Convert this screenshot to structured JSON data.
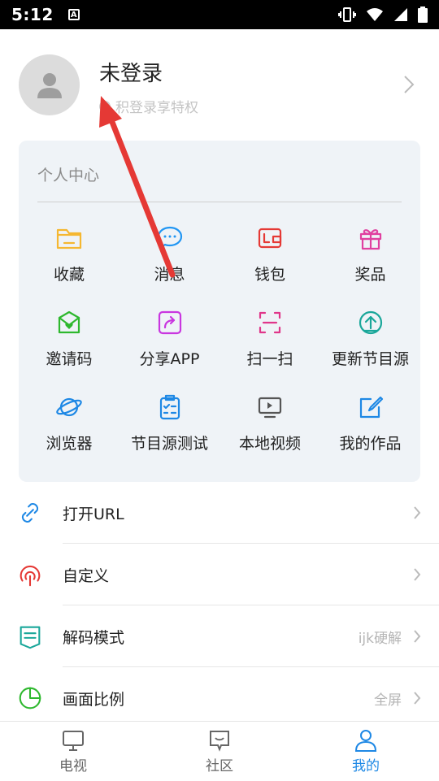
{
  "status_bar": {
    "time": "5:12"
  },
  "profile": {
    "title": "未登录",
    "subtitle": "积登录享特权"
  },
  "personal_center": {
    "title": "个人中心",
    "items": [
      {
        "label": "收藏",
        "icon": "folder-icon",
        "color": "#f5b731"
      },
      {
        "label": "消息",
        "icon": "chat-bubble-icon",
        "color": "#2196f3"
      },
      {
        "label": "钱包",
        "icon": "wallet-icon",
        "color": "#e53935"
      },
      {
        "label": "奖品",
        "icon": "gift-icon",
        "color": "#e040a0"
      },
      {
        "label": "邀请码",
        "icon": "envelope-heart-icon",
        "color": "#2eb82e"
      },
      {
        "label": "分享APP",
        "icon": "share-icon",
        "color": "#c936e0"
      },
      {
        "label": "扫一扫",
        "icon": "scan-icon",
        "color": "#e0368a"
      },
      {
        "label": "更新节目源",
        "icon": "upload-circle-icon",
        "color": "#1aa79a"
      },
      {
        "label": "浏览器",
        "icon": "planet-icon",
        "color": "#1e88e5"
      },
      {
        "label": "节目源测试",
        "icon": "clipboard-check-icon",
        "color": "#1e88e5"
      },
      {
        "label": "本地视频",
        "icon": "monitor-play-icon",
        "color": "#555555"
      },
      {
        "label": "我的作品",
        "icon": "edit-square-icon",
        "color": "#1e88e5"
      }
    ]
  },
  "settings_list": [
    {
      "label": "打开URL",
      "value": "",
      "icon": "link-icon",
      "color": "#1e88e5"
    },
    {
      "label": "自定义",
      "value": "",
      "icon": "custom-icon",
      "color": "#e53935"
    },
    {
      "label": "解码模式",
      "value": "ijk硬解",
      "icon": "tag-list-icon",
      "color": "#1aa79a"
    },
    {
      "label": "画面比例",
      "value": "全屏",
      "icon": "pie-chart-icon",
      "color": "#2eb82e"
    }
  ],
  "tab_bar": [
    {
      "label": "电视",
      "icon": "tv-icon",
      "active": false
    },
    {
      "label": "社区",
      "icon": "community-icon",
      "active": false
    },
    {
      "label": "我的",
      "icon": "person-icon",
      "active": true
    }
  ],
  "colors": {
    "accent": "#1e88e5",
    "annotation_arrow": "#e53935",
    "panel_bg": "#eff3f7"
  }
}
